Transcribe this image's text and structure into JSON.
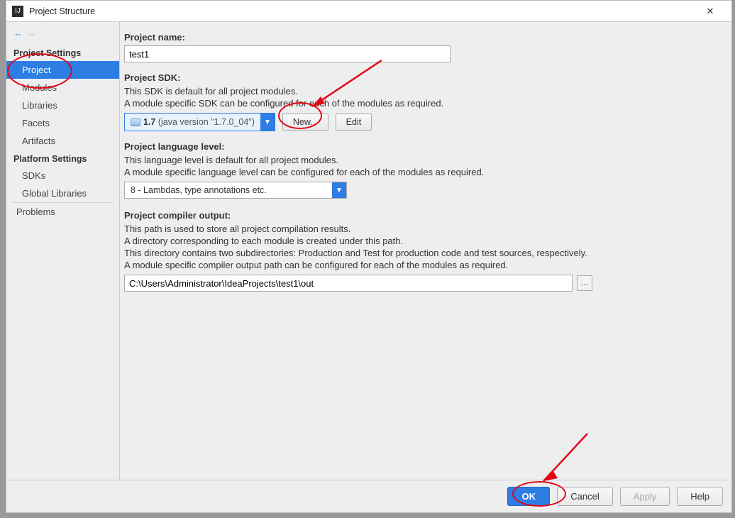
{
  "titlebar": {
    "title": "Project Structure"
  },
  "sidebar": {
    "section1": "Project Settings",
    "items1": [
      "Project",
      "Modules",
      "Libraries",
      "Facets",
      "Artifacts"
    ],
    "section2": "Platform Settings",
    "items2": [
      "SDKs",
      "Global Libraries"
    ],
    "items3": [
      "Problems"
    ],
    "selected": "Project"
  },
  "project_name": {
    "label": "Project name:",
    "value": "test1"
  },
  "project_sdk": {
    "label": "Project SDK:",
    "desc1": "This SDK is default for all project modules.",
    "desc2": "A module specific SDK can be configured for each of the modules as required.",
    "combo_version": "1.7",
    "combo_detail": " (java version \"1.7.0_04\")",
    "new_btn": "New...",
    "edit_btn": "Edit"
  },
  "lang_level": {
    "label": "Project language level:",
    "desc1": "This language level is default for all project modules.",
    "desc2": "A module specific language level can be configured for each of the modules as required.",
    "value": "8 - Lambdas, type annotations etc."
  },
  "compiler_out": {
    "label": "Project compiler output:",
    "desc1": "This path is used to store all project compilation results.",
    "desc2": "A directory corresponding to each module is created under this path.",
    "desc3": "This directory contains two subdirectories: Production and Test for production code and test sources, respectively.",
    "desc4": "A module specific compiler output path can be configured for each of the modules as required.",
    "value": "C:\\Users\\Administrator\\IdeaProjects\\test1\\out"
  },
  "footer": {
    "ok": "OK",
    "cancel": "Cancel",
    "apply": "Apply",
    "help": "Help"
  }
}
